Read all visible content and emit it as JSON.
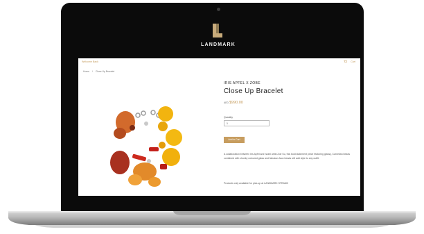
{
  "brand": {
    "name": "LANDMARK"
  },
  "topbar": {
    "welcome": "Welcome Back",
    "cart": "Cart"
  },
  "breadcrumb": [
    "Home",
    "/",
    "Close Up Bracelet"
  ],
  "product": {
    "designer": "IRIS APFEL X ZOBE",
    "title": "Close Up Bracelet",
    "currency": "AED",
    "price": "$990.00",
    "quantity_label": "Quantity",
    "quantity_value": "1",
    "add_button": "Add to Cart",
    "description": "A collaboration between Iris Apfel and Israel artist Zoe Su, this bold statement piece featuring glassy, Carnelian beads combined with chunky coloured glass and fabulous faux beads will add style to any outfit.",
    "pickup_note": "Products only available for pick-up at LANDMARK STRAND"
  },
  "colors": {
    "accent": "#c79d5f",
    "bezel": "#0b0b0b"
  }
}
